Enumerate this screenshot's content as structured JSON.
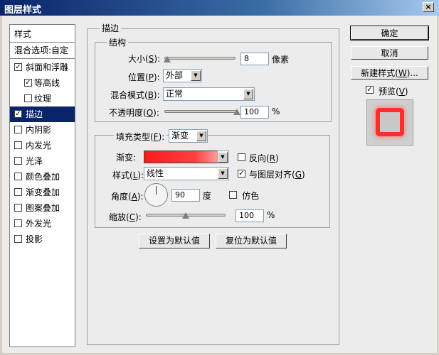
{
  "window": {
    "title": "图层样式",
    "close_glyph": "×"
  },
  "sidebar": {
    "header": "样式",
    "blend_options": "混合选项:自定",
    "items": [
      {
        "label": "斜面和浮雕",
        "checked": true,
        "check": "✓"
      },
      {
        "label": "等高线",
        "checked": true,
        "check": "✓",
        "sub": true
      },
      {
        "label": "纹理",
        "checked": false,
        "check": "",
        "sub": true
      },
      {
        "label": "描边",
        "checked": true,
        "check": "✓",
        "selected": true
      },
      {
        "label": "内阴影",
        "checked": false,
        "check": ""
      },
      {
        "label": "内发光",
        "checked": false,
        "check": ""
      },
      {
        "label": "光泽",
        "checked": false,
        "check": ""
      },
      {
        "label": "颜色叠加",
        "checked": false,
        "check": ""
      },
      {
        "label": "渐变叠加",
        "checked": false,
        "check": ""
      },
      {
        "label": "图案叠加",
        "checked": false,
        "check": ""
      },
      {
        "label": "外发光",
        "checked": false,
        "check": ""
      },
      {
        "label": "投影",
        "checked": false,
        "check": ""
      }
    ]
  },
  "stroke": {
    "title": "描边",
    "structure": {
      "title": "结构",
      "size_label": "大小(",
      "size_key": "S",
      "size_value": "8",
      "size_unit": "像素",
      "size_slider": 0.04,
      "position_label": "位置(",
      "position_key": "P",
      "position_value": "外部",
      "blend_label": "混合模式(",
      "blend_key": "B",
      "blend_value": "正常",
      "opacity_label": "不透明度(",
      "opacity_key": "O",
      "opacity_value": "100",
      "opacity_unit": "%",
      "opacity_slider": 1.0
    },
    "fill": {
      "type_label": "填充类型(",
      "type_key": "F",
      "type_value": "渐变",
      "gradient_label": "渐变:",
      "reverse_label": "反向(",
      "reverse_key": "R",
      "reverse_checked": false,
      "style_label": "样式(",
      "style_key": "L",
      "style_value": "线性",
      "align_label": "与图层对齐(",
      "align_key": "G",
      "align_checked": true,
      "angle_label": "角度(",
      "angle_key": "A",
      "angle_value": "90",
      "angle_unit": "度",
      "dither_label": "仿色",
      "dither_checked": false,
      "scale_label": "缩放(",
      "scale_key": "C",
      "scale_value": "100",
      "scale_unit": "%",
      "scale_slider": 0.5
    },
    "set_default": "设置为默认值",
    "reset_default": "复位为默认值"
  },
  "buttons": {
    "ok": "确定",
    "cancel": "取消",
    "new_style_prefix": "新建样式(",
    "new_style_key": "W",
    "new_style_suffix": ")...",
    "preview_label": "预览(",
    "preview_key": "V",
    "preview_checked": true
  },
  "colors": {
    "titlebar": "#0a246a",
    "selected": "#0a246a",
    "stroke": "#ff2e2e"
  },
  "check_mark": "✓",
  "close_paren": ")",
  "dropdown_arrow": "▼"
}
